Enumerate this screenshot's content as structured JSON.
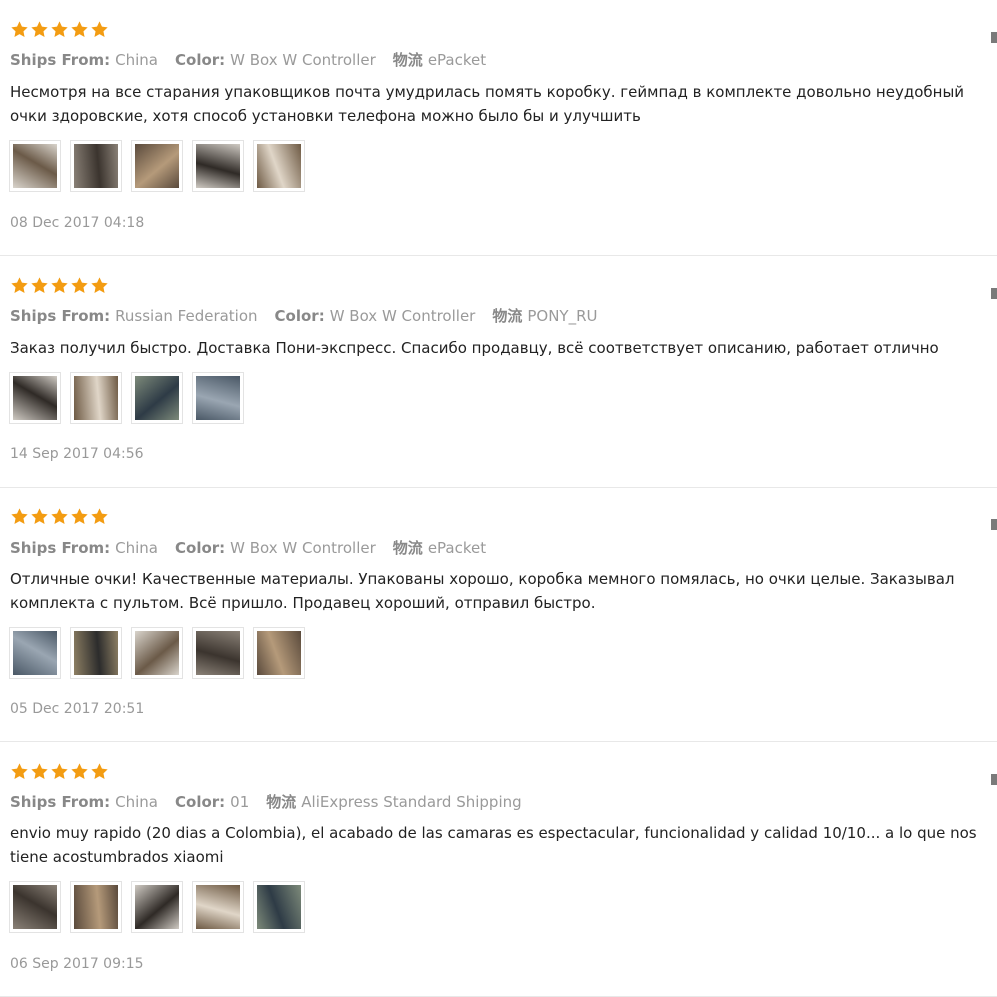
{
  "colors": {
    "star": "#f39c12",
    "label": "#888888",
    "value": "#9a9a9a",
    "text": "#222222",
    "date": "#999999"
  },
  "labels": {
    "ships_from": "Ships From:",
    "color": "Color:",
    "logistics": "物流"
  },
  "reviews": [
    {
      "rating": 5,
      "ships_from": "China",
      "color": "W Box W Controller",
      "logistics": "ePacket",
      "text_lines": [
        "Несмотря на все старания упаковщиков почта умудрилась помять коробку. геймпад в комплекте довольно неудобный",
        "очки здоровские, хотя способ установки телефона можно было бы и улучшить"
      ],
      "photos": [
        {
          "icon": "photo-thumbnail"
        },
        {
          "icon": "photo-thumbnail"
        },
        {
          "icon": "photo-thumbnail"
        },
        {
          "icon": "photo-thumbnail"
        },
        {
          "icon": "photo-thumbnail"
        }
      ],
      "date": "08 Dec 2017 04:18"
    },
    {
      "rating": 5,
      "ships_from": "Russian Federation",
      "color": "W Box W Controller",
      "logistics": "PONY_RU",
      "text_lines": [
        "Заказ получил быстро. Доставка Пони-экспресс. Спасибо продавцу, всё соответствует описанию, работает отлично"
      ],
      "photos": [
        {
          "icon": "photo-thumbnail"
        },
        {
          "icon": "photo-thumbnail"
        },
        {
          "icon": "photo-thumbnail"
        },
        {
          "icon": "photo-thumbnail"
        }
      ],
      "date": "14 Sep 2017 04:56"
    },
    {
      "rating": 5,
      "ships_from": "China",
      "color": "W Box W Controller",
      "logistics": "ePacket",
      "text_lines": [
        "Отличные очки! Качественные материалы. Упакованы хорошо, коробка мемного помялась, но очки целые. Заказывал",
        "комплекта с пультом. Всё пришло. Продавец хороший, отправил быстро."
      ],
      "photos": [
        {
          "icon": "photo-thumbnail"
        },
        {
          "icon": "photo-thumbnail"
        },
        {
          "icon": "photo-thumbnail"
        },
        {
          "icon": "photo-thumbnail"
        },
        {
          "icon": "photo-thumbnail"
        }
      ],
      "date": "05 Dec 2017 20:51"
    },
    {
      "rating": 5,
      "ships_from": "China",
      "color": "01",
      "logistics": "AliExpress Standard Shipping",
      "text_lines": [
        "envio muy rapido (20 dias a Colombia), el acabado de las camaras es espectacular, funcionalidad y calidad 10/10... a lo que nos",
        "tiene acostumbrados xiaomi"
      ],
      "photos": [
        {
          "icon": "photo-thumbnail"
        },
        {
          "icon": "photo-thumbnail"
        },
        {
          "icon": "photo-thumbnail"
        },
        {
          "icon": "photo-thumbnail"
        },
        {
          "icon": "photo-thumbnail"
        }
      ],
      "date": "06 Sep 2017 09:15"
    }
  ]
}
